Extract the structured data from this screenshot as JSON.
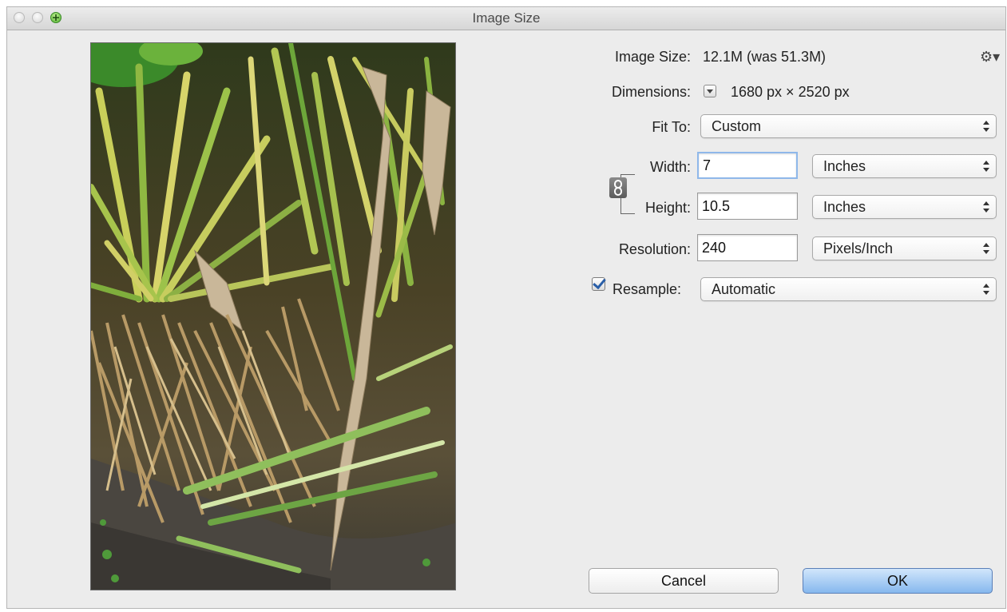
{
  "window": {
    "title": "Image Size"
  },
  "info": {
    "image_size_label": "Image Size:",
    "image_size_value": "12.1M (was 51.3M)",
    "dimensions_label": "Dimensions:",
    "dimensions_value": "1680 px  ×  2520 px"
  },
  "fit_to": {
    "label": "Fit To:",
    "value": "Custom"
  },
  "width": {
    "label": "Width:",
    "value": "7",
    "unit": "Inches"
  },
  "height": {
    "label": "Height:",
    "value": "10.5",
    "unit": "Inches"
  },
  "resolution": {
    "label": "Resolution:",
    "value": "240",
    "unit": "Pixels/Inch"
  },
  "resample": {
    "label": "Resample:",
    "checked": true,
    "value": "Automatic"
  },
  "buttons": {
    "cancel": "Cancel",
    "ok": "OK"
  },
  "icons": {
    "settings": "gear-icon",
    "constrain": "chain-link-icon"
  },
  "colors": {
    "accent": "#86b8ee",
    "check": "#2a5fa8"
  }
}
